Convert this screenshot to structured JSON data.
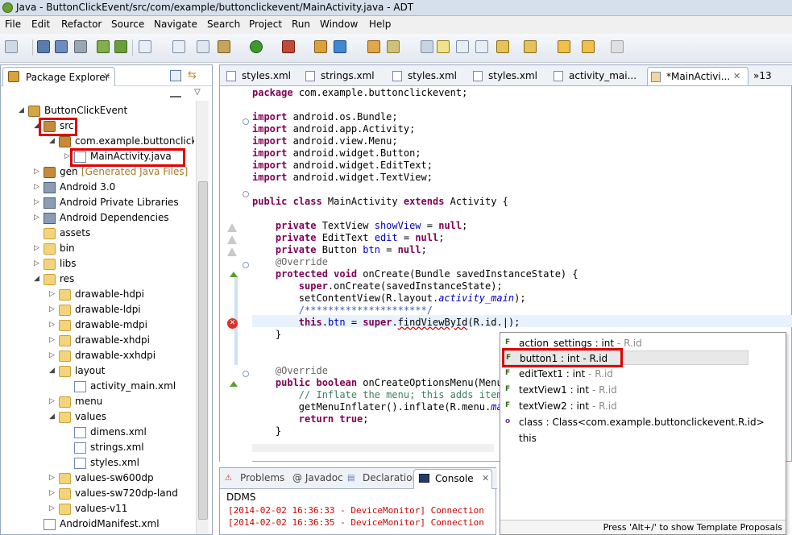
{
  "window": {
    "title": "Java - ButtonClickEvent/src/com/example/buttonclickevent/MainActivity.java - ADT"
  },
  "menubar": {
    "items": [
      "File",
      "Edit",
      "Refactor",
      "Source",
      "Navigate",
      "Search",
      "Project",
      "Run",
      "Window",
      "Help"
    ]
  },
  "package_explorer": {
    "tab_label": "Package Explorer",
    "tree": [
      {
        "label": "ButtonClickEvent",
        "suffix": ""
      },
      {
        "label": "src",
        "suffix": ""
      },
      {
        "label": "com.example.buttonclicke",
        "suffix": ""
      },
      {
        "label": "MainActivity.java",
        "suffix": ""
      },
      {
        "label": "gen",
        "suffix": "[Generated Java Files]"
      },
      {
        "label": "Android 3.0",
        "suffix": ""
      },
      {
        "label": "Android Private Libraries",
        "suffix": ""
      },
      {
        "label": "Android Dependencies",
        "suffix": ""
      },
      {
        "label": "assets",
        "suffix": ""
      },
      {
        "label": "bin",
        "suffix": ""
      },
      {
        "label": "libs",
        "suffix": ""
      },
      {
        "label": "res",
        "suffix": ""
      },
      {
        "label": "drawable-hdpi",
        "suffix": ""
      },
      {
        "label": "drawable-ldpi",
        "suffix": ""
      },
      {
        "label": "drawable-mdpi",
        "suffix": ""
      },
      {
        "label": "drawable-xhdpi",
        "suffix": ""
      },
      {
        "label": "drawable-xxhdpi",
        "suffix": ""
      },
      {
        "label": "layout",
        "suffix": ""
      },
      {
        "label": "activity_main.xml",
        "suffix": ""
      },
      {
        "label": "menu",
        "suffix": ""
      },
      {
        "label": "values",
        "suffix": ""
      },
      {
        "label": "dimens.xml",
        "suffix": ""
      },
      {
        "label": "strings.xml",
        "suffix": ""
      },
      {
        "label": "styles.xml",
        "suffix": ""
      },
      {
        "label": "values-sw600dp",
        "suffix": ""
      },
      {
        "label": "values-sw720dp-land",
        "suffix": ""
      },
      {
        "label": "values-v11",
        "suffix": ""
      },
      {
        "label": "AndroidManifest.xml",
        "suffix": ""
      }
    ]
  },
  "editor": {
    "tabs": [
      "styles.xml",
      "strings.xml",
      "styles.xml",
      "styles.xml",
      "activity_mai...",
      "*MainActivi...",
      "»13"
    ],
    "code": [
      "package com.example.buttonclickevent;",
      "",
      "import android.os.Bundle;",
      "import android.app.Activity;",
      "import android.view.Menu;",
      "import android.widget.Button;",
      "import android.widget.EditText;",
      "import android.widget.TextView;",
      "",
      "public class MainActivity extends Activity {",
      "",
      "    private TextView showView = null;",
      "    private EditText edit = null;",
      "    private Button btn = null;",
      "    @Override",
      "    protected void onCreate(Bundle savedInstanceState) {",
      "        super.onCreate(savedInstanceState);",
      "        setContentView(R.layout.activity_main);",
      "        /*********************/",
      "        this.btn = super.findViewById(R.id.);",
      "    }",
      "",
      "",
      "    @Override",
      "    public boolean onCreateOptionsMenu(Menu",
      "        // Inflate the menu; this adds item",
      "        getMenuInflater().inflate(R.menu.ma",
      "        return true;",
      "    }"
    ]
  },
  "content_assist": {
    "items": [
      {
        "name": "action_settings : int",
        "type": " - R.id"
      },
      {
        "name": "button1 : int - R.id",
        "type": ""
      },
      {
        "name": "editText1 : int",
        "type": " - R.id"
      },
      {
        "name": "textView1 : int",
        "type": " - R.id"
      },
      {
        "name": "textView2 : int",
        "type": " - R.id"
      },
      {
        "name": "class : Class<com.example.buttonclickevent.R.id>",
        "type": ""
      },
      {
        "name": "this",
        "type": ""
      }
    ],
    "footer": "Press 'Alt+/' to show Template Proposals"
  },
  "bottom_panel": {
    "tabs": [
      "Problems",
      "@ Javadoc",
      "Declaration",
      "Console"
    ],
    "title": "DDMS",
    "log": [
      "[2014-02-02 16:36:33 - DeviceMonitor] Connection",
      "[2014-02-02 16:36:35 - DeviceMonitor] Connection"
    ]
  }
}
